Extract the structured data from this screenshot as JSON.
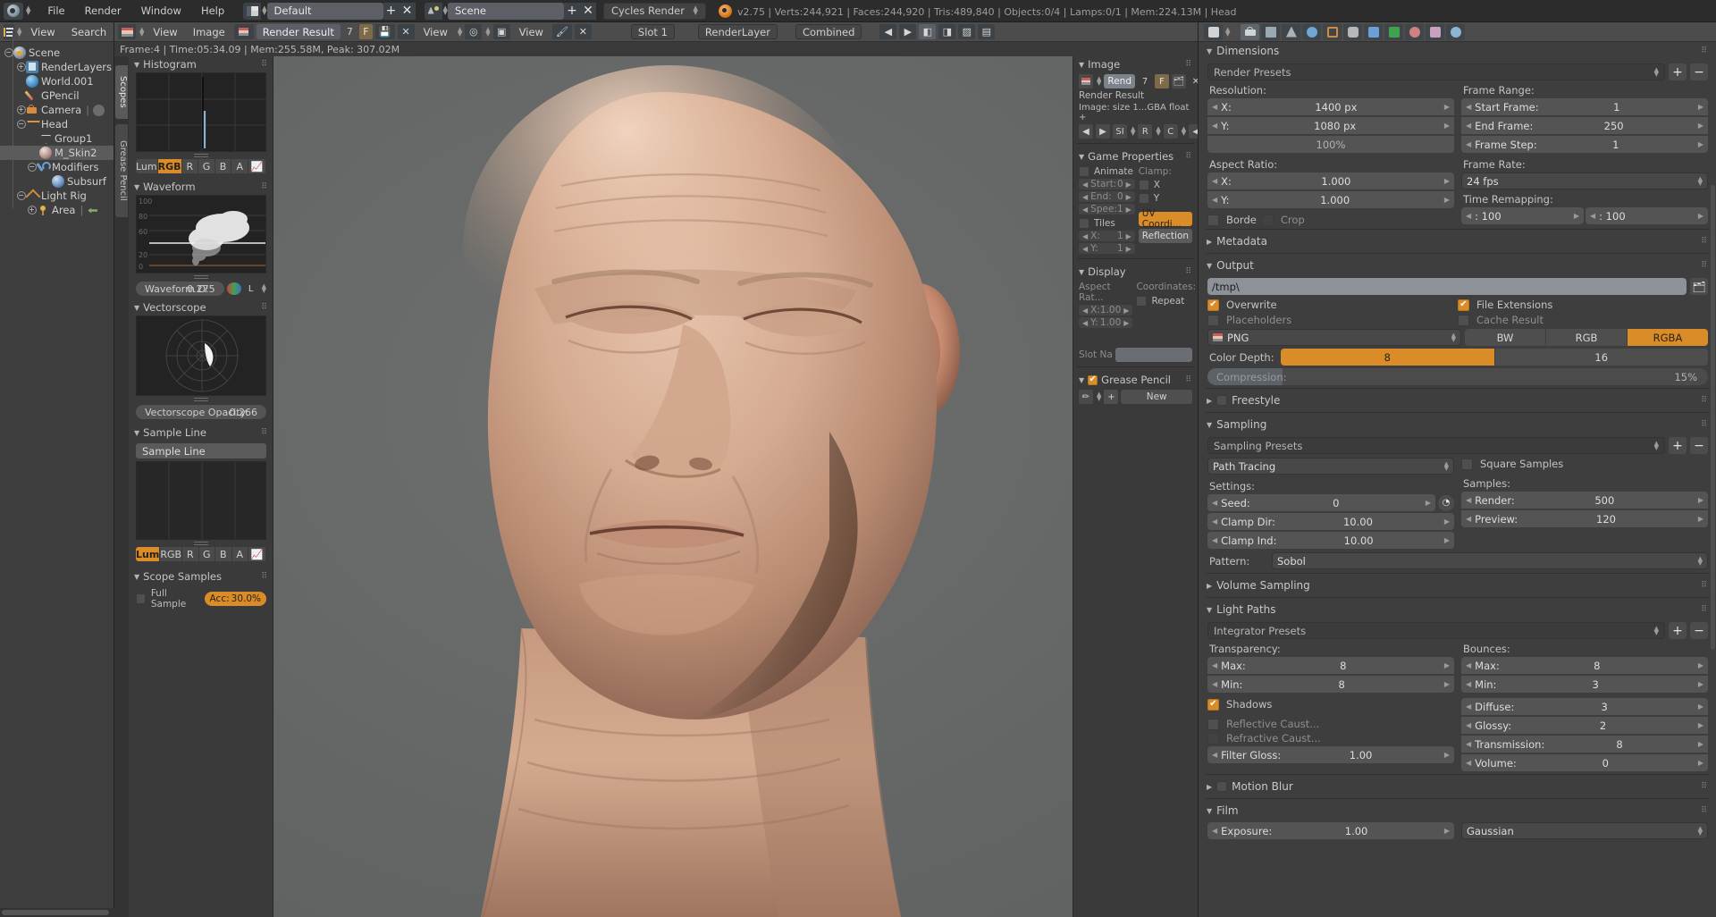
{
  "topbar": {
    "logo_icon": "blender-logo-icon",
    "menus": [
      "File",
      "Render",
      "Window",
      "Help"
    ],
    "screen_layout": "Default",
    "scene_name": "Scene",
    "render_engine": "Cycles Render",
    "add_label": "+",
    "remove_label": "✕",
    "stats": "v2.75 | Verts:244,921 | Faces:244,920 | Tris:489,840 | Objects:0/4 | Lamps:0/1 | Mem:224.13M | Head"
  },
  "outliner": {
    "menus": [
      "View",
      "Search"
    ],
    "rows": [
      {
        "label": "Scene",
        "indent": 0,
        "icon": "scene-icon",
        "expander": "minus",
        "selected": false
      },
      {
        "label": "RenderLayers",
        "indent": 1,
        "icon": "renderlayer-icon",
        "expander": "plus",
        "selected": false
      },
      {
        "label": "World.001",
        "indent": 1,
        "icon": "world-icon",
        "expander": "none",
        "selected": false
      },
      {
        "label": "GPencil",
        "indent": 1,
        "icon": "gpencil-icon",
        "expander": "none",
        "selected": false
      },
      {
        "label": "Camera",
        "indent": 1,
        "icon": "camera-icon",
        "expander": "plus",
        "selected": false
      },
      {
        "label": "Head",
        "indent": 1,
        "icon": "mesh-icon",
        "expander": "minus",
        "selected": false
      },
      {
        "label": "Group1",
        "indent": 2,
        "icon": "group-icon",
        "expander": "none",
        "selected": false
      },
      {
        "label": "M_Skin2",
        "indent": 2,
        "icon": "material-icon",
        "expander": "none",
        "selected": true
      },
      {
        "label": "Modifiers",
        "indent": 2,
        "icon": "wrench-icon",
        "expander": "minus",
        "selected": false
      },
      {
        "label": "Subsurf",
        "indent": 3,
        "icon": "subsurf-icon",
        "expander": "none",
        "selected": false
      },
      {
        "label": "Light Rig",
        "indent": 1,
        "icon": "lightrig-icon",
        "expander": "minus",
        "selected": false
      },
      {
        "label": "Area",
        "indent": 2,
        "icon": "lamp-icon",
        "expander": "plus",
        "selected": false
      }
    ]
  },
  "image_editor": {
    "menus": [
      "View",
      "Image"
    ],
    "image_datablock": "Render Result",
    "image_users": "7",
    "fake_user": "F",
    "slot_label": "Slot 1",
    "layer_label": "RenderLayer",
    "pass_label": "Combined",
    "render_info": "Frame:4 | Time:05:34.09 | Mem:255.58M, Peak: 307.02M"
  },
  "scopes": {
    "tabs": [
      "Scopes",
      "Grease Pencil"
    ],
    "active_tab": "Scopes",
    "histogram": {
      "title": "Histogram",
      "channels": [
        "Lum",
        "RGB",
        "R",
        "G",
        "B",
        "A"
      ],
      "active_channel": "RGB"
    },
    "waveform": {
      "title": "Waveform",
      "opacity_label": "Waveform O:",
      "opacity_value": "0.275",
      "axis_labels": [
        "100",
        "80",
        "60",
        "20",
        "0"
      ],
      "mode_label": "L"
    },
    "vectorscope": {
      "title": "Vectorscope",
      "opacity_label": "Vectorscope Opacity:",
      "opacity_value": "0.266"
    },
    "sample_line": {
      "title": "Sample Line",
      "button_label": "Sample Line",
      "channels": [
        "Lum",
        "RGB",
        "R",
        "G",
        "B",
        "A"
      ],
      "active_channel": "Lum"
    },
    "scope_samples": {
      "title": "Scope Samples",
      "full_sample_label": "Full Sample",
      "accuracy_label": "Acc:",
      "accuracy_value": "30.0%"
    }
  },
  "image_panel": {
    "image": {
      "title": "Image",
      "datablock_name": "Rend",
      "users": "7",
      "fake_user": "F",
      "close_label": "✕",
      "result_label": "Render Result",
      "info_line": "Image: size 1...GBA float +",
      "nav_buttons": [
        "◀",
        "▶",
        "SI",
        "R",
        "C",
        "◀",
        "▶"
      ]
    },
    "game_properties": {
      "title": "Game Properties",
      "animate_label": "Animate",
      "start_label": "Start:",
      "start_value": "0",
      "end_label": "End:",
      "end_value": "0",
      "speed_label": "Spee:",
      "speed_value": "1",
      "tiles_label": "Tiles",
      "tile_x_label": "X:",
      "tile_x_value": "1",
      "tile_y_label": "Y:",
      "tile_y_value": "1",
      "clamp_label": "Clamp:",
      "clamp_x": "X",
      "clamp_y": "Y",
      "uv_coord_label": "UV Coordi...",
      "reflection_label": "Reflection"
    },
    "display": {
      "title": "Display",
      "aspect_label": "Aspect Rat...",
      "aspect_x_label": "X:",
      "aspect_x_value": "1.00",
      "aspect_y_label": "Y:",
      "aspect_y_value": "1.00",
      "coordinates_label": "Coordinates:",
      "repeat_label": "Repeat",
      "slot_name_label": "Slot Na"
    },
    "grease_pencil": {
      "title": "Grease Pencil",
      "new_label": "New",
      "add_label": "+"
    }
  },
  "properties": {
    "dimensions": {
      "title": "Dimensions",
      "presets_label": "Render Presets",
      "resolution_label": "Resolution:",
      "res_x_label": "X:",
      "res_x_value": "1400 px",
      "res_y_label": "Y:",
      "res_y_value": "1080 px",
      "res_percent": "100%",
      "aspect_label": "Aspect Ratio:",
      "aspect_x_label": "X:",
      "aspect_x_value": "1.000",
      "aspect_y_label": "Y:",
      "aspect_y_value": "1.000",
      "border_label": "Borde",
      "crop_label": "Crop",
      "frame_range_label": "Frame Range:",
      "start_frame_label": "Start Frame:",
      "start_frame_value": "1",
      "end_frame_label": "End Frame:",
      "end_frame_value": "250",
      "frame_step_label": "Frame Step:",
      "frame_step_value": "1",
      "frame_rate_label": "Frame Rate:",
      "fps_value": "24 fps",
      "time_remapping_label": "Time Remapping:",
      "remap_old": ": 100",
      "remap_new": ": 100"
    },
    "metadata": {
      "title": "Metadata"
    },
    "output": {
      "title": "Output",
      "path_value": "/tmp\\",
      "overwrite_label": "Overwrite",
      "overwrite_on": true,
      "file_extensions_label": "File Extensions",
      "file_extensions_on": true,
      "placeholders_label": "Placeholders",
      "placeholders_on": false,
      "cache_result_label": "Cache Result",
      "cache_result_on": false,
      "format_value": "PNG",
      "color_modes": [
        "BW",
        "RGB",
        "RGBA"
      ],
      "active_color_mode": "RGBA",
      "color_depth_label": "Color Depth:",
      "color_depths": [
        "8",
        "16"
      ],
      "active_color_depth": "8",
      "compression_label": "Compression:",
      "compression_value": "15%"
    },
    "freestyle": {
      "title": "Freestyle"
    },
    "sampling": {
      "title": "Sampling",
      "presets_label": "Sampling Presets",
      "integrator_value": "Path Tracing",
      "square_samples_label": "Square Samples",
      "settings_label": "Settings:",
      "seed_label": "Seed:",
      "seed_value": "0",
      "clamp_direct_label": "Clamp Dir:",
      "clamp_direct_value": "10.00",
      "clamp_indirect_label": "Clamp Ind:",
      "clamp_indirect_value": "10.00",
      "samples_label": "Samples:",
      "render_label": "Render:",
      "render_value": "500",
      "preview_label": "Preview:",
      "preview_value": "120",
      "pattern_label": "Pattern:",
      "pattern_value": "Sobol"
    },
    "volume_sampling": {
      "title": "Volume Sampling"
    },
    "light_paths": {
      "title": "Light Paths",
      "presets_label": "Integrator Presets",
      "transparency_label": "Transparency:",
      "trans_max_label": "Max:",
      "trans_max_value": "8",
      "trans_min_label": "Min:",
      "trans_min_value": "8",
      "shadows_label": "Shadows",
      "shadows_on": true,
      "reflective_caustics_label": "Reflective Caust...",
      "refractive_caustics_label": "Refractive Caust...",
      "filter_glossy_label": "Filter Gloss:",
      "filter_glossy_value": "1.00",
      "bounces_label": "Bounces:",
      "bounce_max_label": "Max:",
      "bounce_max_value": "8",
      "bounce_min_label": "Min:",
      "bounce_min_value": "3",
      "diffuse_label": "Diffuse:",
      "diffuse_value": "3",
      "glossy_label": "Glossy:",
      "glossy_value": "2",
      "transmission_label": "Transmission:",
      "transmission_value": "8",
      "volume_label": "Volume:",
      "volume_value": "0"
    },
    "motion_blur": {
      "title": "Motion Blur"
    },
    "film": {
      "title": "Film",
      "exposure_label": "Exposure:",
      "exposure_value": "1.00",
      "filter_value": "Gaussian"
    }
  },
  "colors": {
    "accent_orange": "#d98c28",
    "panel_bg": "#3e3e3e",
    "header_bg": "#4c4c4c",
    "canvas_bg": "#666666",
    "field_bg": "#545454"
  }
}
